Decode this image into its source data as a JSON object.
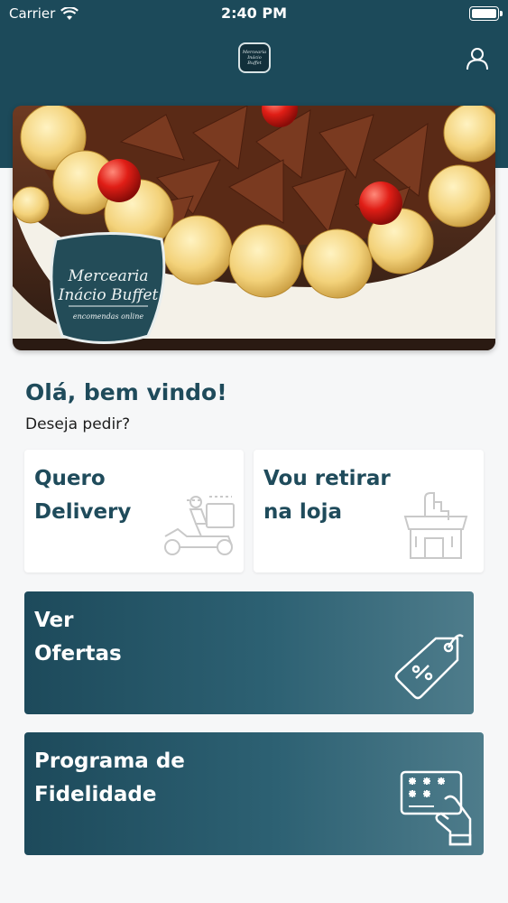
{
  "status_bar": {
    "carrier": "Carrier",
    "time": "2:40 PM"
  },
  "header": {
    "logo_text": [
      "Mercearia",
      "Inácio Buffet"
    ],
    "profile_icon": "user-icon"
  },
  "banner": {
    "logo_lines": [
      "Mercearia",
      "Inácio Buffet"
    ],
    "logo_tagline": "encomendas online"
  },
  "greeting": {
    "title": "Olá, bem vindo!",
    "subtitle": "Deseja pedir?"
  },
  "options": {
    "delivery": {
      "line1": "Quero",
      "line2": "Delivery",
      "icon": "scooter-delivery-icon"
    },
    "pickup": {
      "line1": "Vou retirar",
      "line2": "na loja",
      "icon": "store-pickup-icon"
    },
    "offers": {
      "line1": "Ver",
      "line2": "Ofertas",
      "icon": "price-tag-icon"
    },
    "loyalty": {
      "line1": "Programa de",
      "line2": "Fidelidade",
      "icon": "loyalty-card-icon"
    }
  },
  "colors": {
    "brand": "#1c4a5a",
    "background": "#f6f7f8",
    "icon_gray": "#c9c9c9"
  }
}
